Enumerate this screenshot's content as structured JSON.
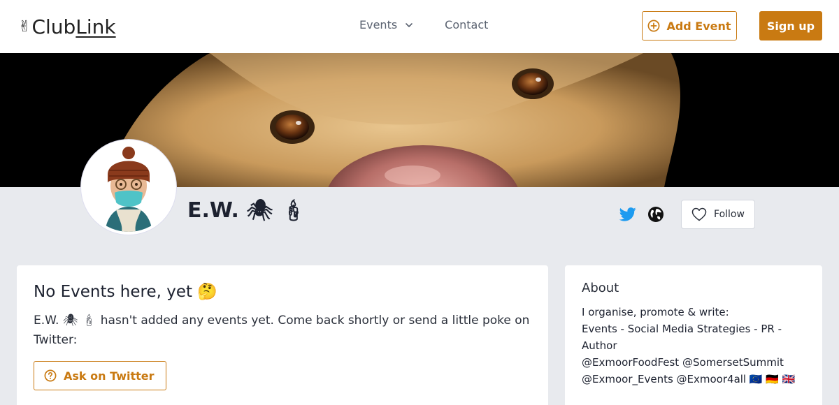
{
  "header": {
    "logo_club": "Club",
    "logo_link": "Link",
    "nav_events": "Events",
    "nav_contact": "Contact",
    "add_event": "Add Event",
    "sign_up": "Sign up"
  },
  "profile": {
    "name": "E.W. 🕷 🕯",
    "follow": "Follow"
  },
  "events": {
    "title": "No Events here, yet 🤔",
    "text": "E.W. 🕷 🕯 hasn't added any events yet. Come back shortly or send a little poke on Twitter:",
    "ask_button": "Ask on Twitter"
  },
  "about": {
    "title": "About",
    "lines": [
      "I organise, promote & write:",
      "Events - Social Media Strategies - PR - Author",
      "@ExmoorFoodFest @SomersetSummit @Exmoor_Events @Exmoor4all 🇪🇺 🇩🇪 🇬🇧"
    ]
  },
  "colors": {
    "accent": "#c97a12",
    "twitter": "#1d9bf0",
    "page_bg": "#e8eaee"
  }
}
